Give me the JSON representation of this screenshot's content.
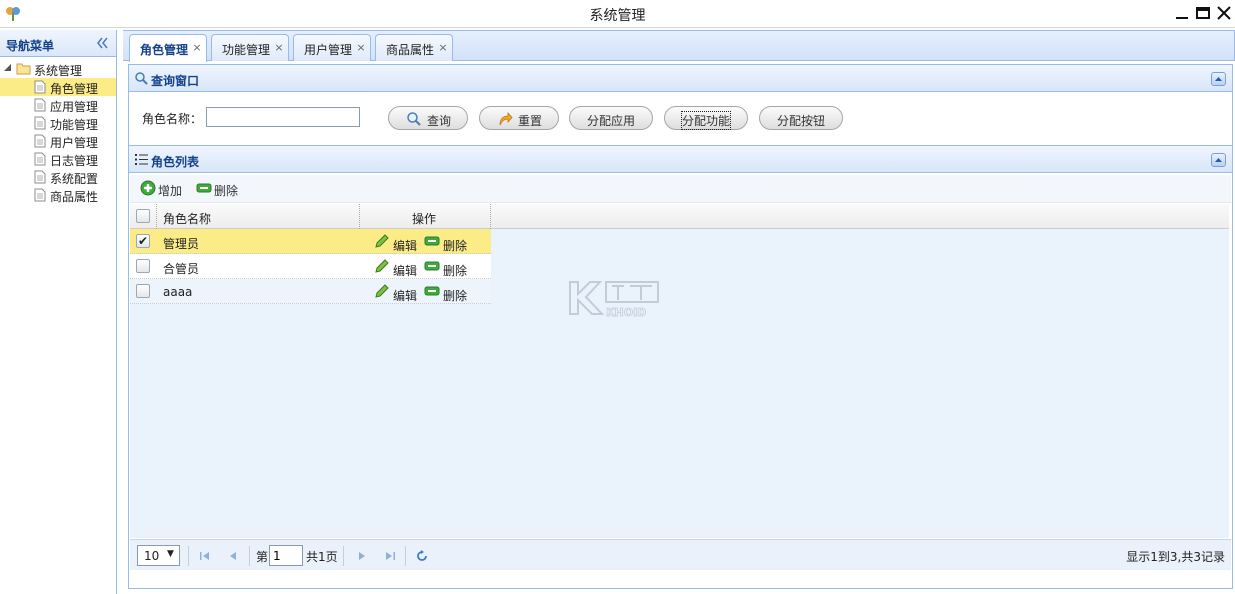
{
  "window": {
    "title": "系统管理"
  },
  "sidebar": {
    "title": "导航菜单",
    "root": {
      "label": "系统管理"
    },
    "items": [
      {
        "label": "角色管理",
        "selected": true
      },
      {
        "label": "应用管理"
      },
      {
        "label": "功能管理"
      },
      {
        "label": "用户管理"
      },
      {
        "label": "日志管理"
      },
      {
        "label": "系统配置"
      },
      {
        "label": "商品属性"
      }
    ]
  },
  "tabs": [
    {
      "label": "角色管理",
      "active": true
    },
    {
      "label": "功能管理"
    },
    {
      "label": "用户管理"
    },
    {
      "label": "商品属性"
    }
  ],
  "tab_close_glyph": "×",
  "query": {
    "title": "查询窗口",
    "role_name_label": "角色名称：",
    "role_name_value": "",
    "buttons": {
      "search": "查询",
      "reset": "重置",
      "assign_app": "分配应用",
      "assign_func": "分配功能",
      "assign_button": "分配按钮"
    }
  },
  "list": {
    "title": "角色列表",
    "toolbar": {
      "add": "增加",
      "delete": "删除"
    },
    "columns": {
      "name": "角色名称",
      "ops": "操作"
    },
    "row_actions": {
      "edit": "编辑",
      "delete": "删除"
    },
    "rows": [
      {
        "name": "管理员",
        "checked": true
      },
      {
        "name": "合管员",
        "checked": false
      },
      {
        "name": "aaaa",
        "checked": false
      }
    ]
  },
  "pager": {
    "page_size": "10",
    "page_prefix": "第",
    "page_value": "1",
    "page_total": "共1页",
    "summary": "显示1到3,共3记录"
  },
  "watermark": {
    "text": "KHOID"
  },
  "colors": {
    "accent": "#15428b",
    "selected_row": "#fbec88",
    "border": "#99bbe8"
  }
}
